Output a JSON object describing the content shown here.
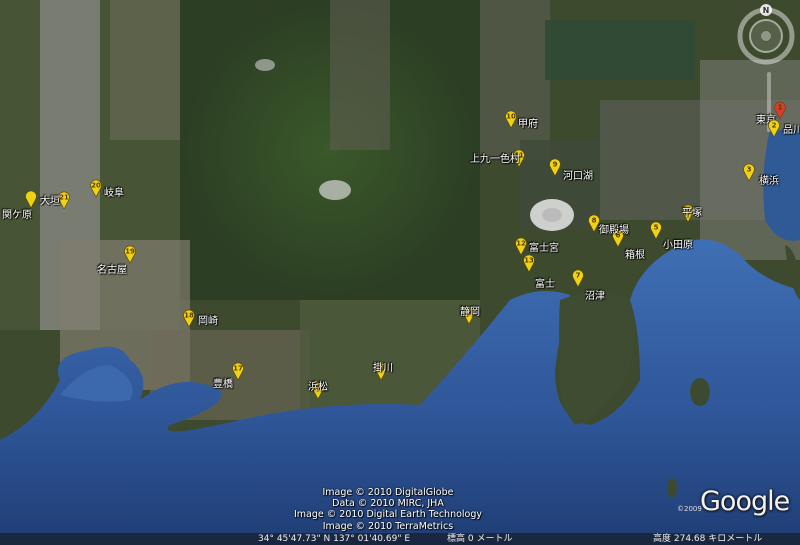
{
  "map": {
    "navigation": {
      "north_label": "N"
    },
    "status": {
      "coords": "34° 45'47.73\" N    137° 01'40.69\" E",
      "elevation": "標高    0 メートル",
      "eye_altitude": "高度    274.68 キロメートル"
    },
    "credits": [
      "Image © 2010 DigitalGlobe",
      "Data © 2010 MIRC, JHA",
      "Image © 2010 Digital Earth Technology",
      "Image © 2010 TerraMetrics"
    ],
    "logo": {
      "text": "Google",
      "year": "©2009"
    },
    "colors": {
      "pin": "#f0d214",
      "pin_start": "#d93c2c",
      "sea": "#3a6bb0",
      "land": "#3b4a2c"
    },
    "places": [
      {
        "num": "1",
        "name": "品川"
      },
      {
        "num": "",
        "name": "東京"
      },
      {
        "num": "2",
        "name": ""
      },
      {
        "num": "3",
        "name": "横浜"
      },
      {
        "num": "4",
        "name": "平塚"
      },
      {
        "num": "5",
        "name": "小田原"
      },
      {
        "num": "6",
        "name": "箱根"
      },
      {
        "num": "8",
        "name": "御殿場"
      },
      {
        "num": "9",
        "name": "河口湖"
      },
      {
        "num": "10",
        "name": "甲府"
      },
      {
        "num": "11",
        "name": "上九一色村"
      },
      {
        "num": "12",
        "name": "富士宮"
      },
      {
        "num": "13",
        "name": "富士"
      },
      {
        "num": "7",
        "name": "沼津"
      },
      {
        "num": "14",
        "name": "静岡"
      },
      {
        "num": "15",
        "name": "掛川"
      },
      {
        "num": "16",
        "name": "浜松"
      },
      {
        "num": "17",
        "name": "豊橋"
      },
      {
        "num": "18",
        "name": "岡崎"
      },
      {
        "num": "19",
        "name": "名古屋"
      },
      {
        "num": "20",
        "name": "岐阜"
      },
      {
        "num": "21",
        "name": "大垣"
      },
      {
        "num": "",
        "name": "関ケ原"
      }
    ]
  }
}
